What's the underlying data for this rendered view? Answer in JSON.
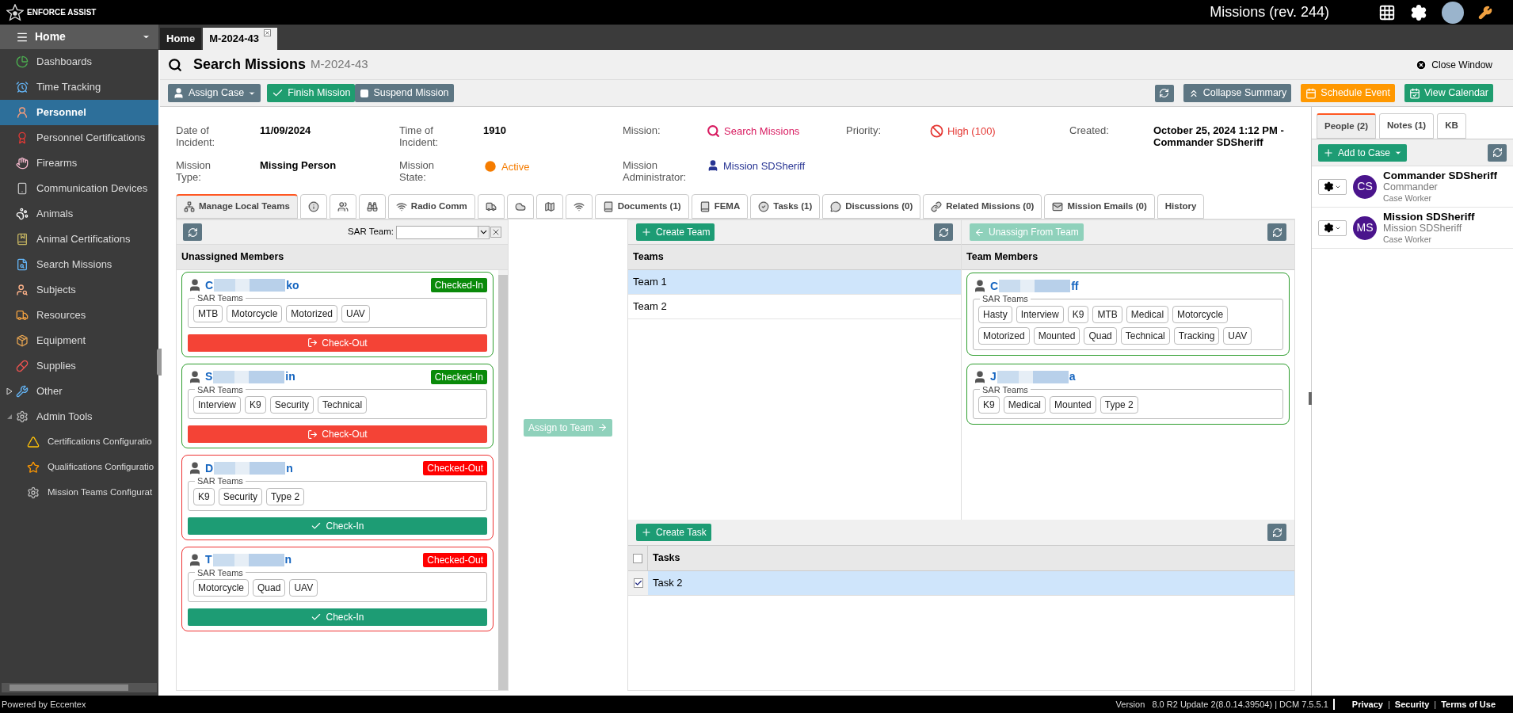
{
  "app": {
    "logo_text": "ENFORCE ASSIST",
    "title": "Missions (rev. 244)"
  },
  "sidebar": {
    "header": "Home",
    "items": [
      {
        "label": "Dashboards",
        "selected": false
      },
      {
        "label": "Time Tracking",
        "selected": false
      },
      {
        "label": "Personnel",
        "selected": true
      },
      {
        "label": "Personnel Certifications",
        "selected": false
      },
      {
        "label": "Firearms",
        "selected": false
      },
      {
        "label": "Communication Devices",
        "selected": false
      },
      {
        "label": "Animals",
        "selected": false
      },
      {
        "label": "Animal Certifications",
        "selected": false
      },
      {
        "label": "Search Missions",
        "selected": false
      },
      {
        "label": "Subjects",
        "selected": false
      },
      {
        "label": "Resources",
        "selected": false
      },
      {
        "label": "Equipment",
        "selected": false
      },
      {
        "label": "Supplies",
        "selected": false
      },
      {
        "label": "Other",
        "selected": false,
        "expanded": false
      },
      {
        "label": "Admin Tools",
        "selected": false,
        "expanded": true,
        "children": [
          {
            "label": "Certifications Configuratio",
            "selected": false
          },
          {
            "label": "Qualifications Configuratio",
            "selected": false
          },
          {
            "label": "Mission Teams Configurat",
            "selected": false
          }
        ]
      }
    ]
  },
  "doc_tabs": [
    {
      "label": "Home",
      "selected": false,
      "closable": false
    },
    {
      "label": "M-2024-43",
      "selected": true,
      "closable": true
    }
  ],
  "page": {
    "title": "Search Missions",
    "subtitle": "M-2024-43",
    "close": "Close Window"
  },
  "toolbar": {
    "left": [
      {
        "label": "Assign Case",
        "kind": "dropdown"
      },
      {
        "label": "Finish Mission",
        "kind": "success"
      },
      {
        "label": "Suspend Mission",
        "kind": "toggle"
      }
    ],
    "right": [
      {
        "kind": "refresh"
      },
      {
        "label": "Collapse Summary",
        "kind": "secondary"
      },
      {
        "label": "Schedule Event",
        "kind": "warning"
      },
      {
        "label": "View Calendar",
        "kind": "success"
      }
    ]
  },
  "summary": [
    {
      "label": "Date of Incident:",
      "value": "11/09/2024",
      "kind": "bold"
    },
    {
      "label": "Time of Incident:",
      "value": "1910",
      "kind": "bold"
    },
    {
      "label": "Mission:",
      "value": "Search Missions",
      "kind": "mission"
    },
    {
      "label": "Priority:",
      "value": "High (100)",
      "kind": "priority"
    },
    {
      "label": "Created:",
      "value": "October 25, 2024 1:12 PM - Commander SDSheriff",
      "kind": "bold"
    },
    {
      "label": "Mission Type:",
      "value": "Missing Person",
      "kind": "bold"
    },
    {
      "label": "Mission State:",
      "value": "Active",
      "kind": "state"
    },
    {
      "label": "Mission Administrator:",
      "value": "Mission SDSheriff",
      "kind": "person"
    }
  ],
  "tabs": [
    {
      "label": "Manage Local Teams",
      "selected": true
    },
    {
      "selected": false
    },
    {
      "selected": false
    },
    {
      "selected": false
    },
    {
      "label": "Radio Comm",
      "selected": false
    },
    {
      "selected": false
    },
    {
      "selected": false
    },
    {
      "selected": false
    },
    {
      "selected": false
    },
    {
      "label": "Documents (1)",
      "selected": false
    },
    {
      "label": "FEMA",
      "selected": false
    },
    {
      "label": "Tasks (1)",
      "selected": false
    },
    {
      "label": "Discussions (0)",
      "selected": false
    },
    {
      "label": "Related Missions (0)",
      "selected": false
    },
    {
      "label": "Mission Emails (0)",
      "selected": false
    },
    {
      "label": "History",
      "selected": false
    }
  ],
  "members_panel": {
    "filter_label": "SAR Team:",
    "header": "Unassigned Members",
    "members": [
      {
        "name_start": "C",
        "name_end": "ko",
        "status": "Checked-In",
        "checked_in": true,
        "group_label": "SAR Teams",
        "teams": [
          "MTB",
          "Motorcycle",
          "Motorized",
          "UAV"
        ],
        "action": "Check-Out"
      },
      {
        "name_start": "S",
        "name_end": "in",
        "status": "Checked-In",
        "checked_in": true,
        "group_label": "SAR Teams",
        "teams": [
          "Interview",
          "K9",
          "Security",
          "Technical"
        ],
        "action": "Check-Out"
      },
      {
        "name_start": "D",
        "name_end": "n",
        "status": "Checked-Out",
        "checked_in": false,
        "group_label": "SAR Teams",
        "teams": [
          "K9",
          "Security",
          "Type 2"
        ],
        "action": "Check-In"
      },
      {
        "name_start": "T",
        "name_end": "n",
        "status": "Checked-Out",
        "checked_in": false,
        "group_label": "SAR Teams",
        "teams": [
          "Motorcycle",
          "Quad",
          "UAV"
        ],
        "action": "Check-In"
      }
    ]
  },
  "assign_button": {
    "label": "Assign to Team",
    "disabled": true
  },
  "teams_panel": {
    "create": "Create Team",
    "header": "Teams",
    "rows": [
      {
        "label": "Team 1",
        "selected": true
      },
      {
        "label": "Team 2",
        "selected": false
      }
    ]
  },
  "team_members_panel": {
    "unassign": {
      "label": "Unassign From Team",
      "disabled": true
    },
    "header": "Team Members",
    "members": [
      {
        "name_start": "C",
        "name_end": "ff",
        "group_label": "SAR Teams",
        "teams": [
          "Hasty",
          "Interview",
          "K9",
          "MTB",
          "Medical",
          "Motorcycle",
          "Motorized",
          "Mounted",
          "Quad",
          "Technical",
          "Tracking",
          "UAV"
        ]
      },
      {
        "name_start": "J",
        "name_end": "a",
        "group_label": "SAR Teams",
        "teams": [
          "K9",
          "Medical",
          "Mounted",
          "Type 2"
        ]
      }
    ]
  },
  "tasks_panel": {
    "create": "Create Task",
    "header": "Tasks",
    "header_checked": false,
    "rows": [
      {
        "label": "Task 2",
        "checked": true,
        "selected": true
      }
    ]
  },
  "people_panel": {
    "tabs": [
      {
        "label": "People (2)",
        "selected": true
      },
      {
        "label": "Notes (1)",
        "selected": false
      },
      {
        "label": "KB",
        "selected": false
      }
    ],
    "add": "Add to Case",
    "people": [
      {
        "initials": "CS",
        "name": "Commander SDSheriff",
        "role": "Commander",
        "type": "Case Worker"
      },
      {
        "initials": "MS",
        "name": "Mission SDSheriff",
        "role": "Mission SDSheriff",
        "type": "Case Worker"
      }
    ]
  },
  "footer": {
    "powered": "Powered by Eccentex",
    "version": "Version   8.0 R2 Update 2(8.0.14.39504) | DCM 7.5.5.1",
    "separator": "|",
    "links": [
      "Privacy",
      "Security",
      "Terms of Use"
    ]
  }
}
